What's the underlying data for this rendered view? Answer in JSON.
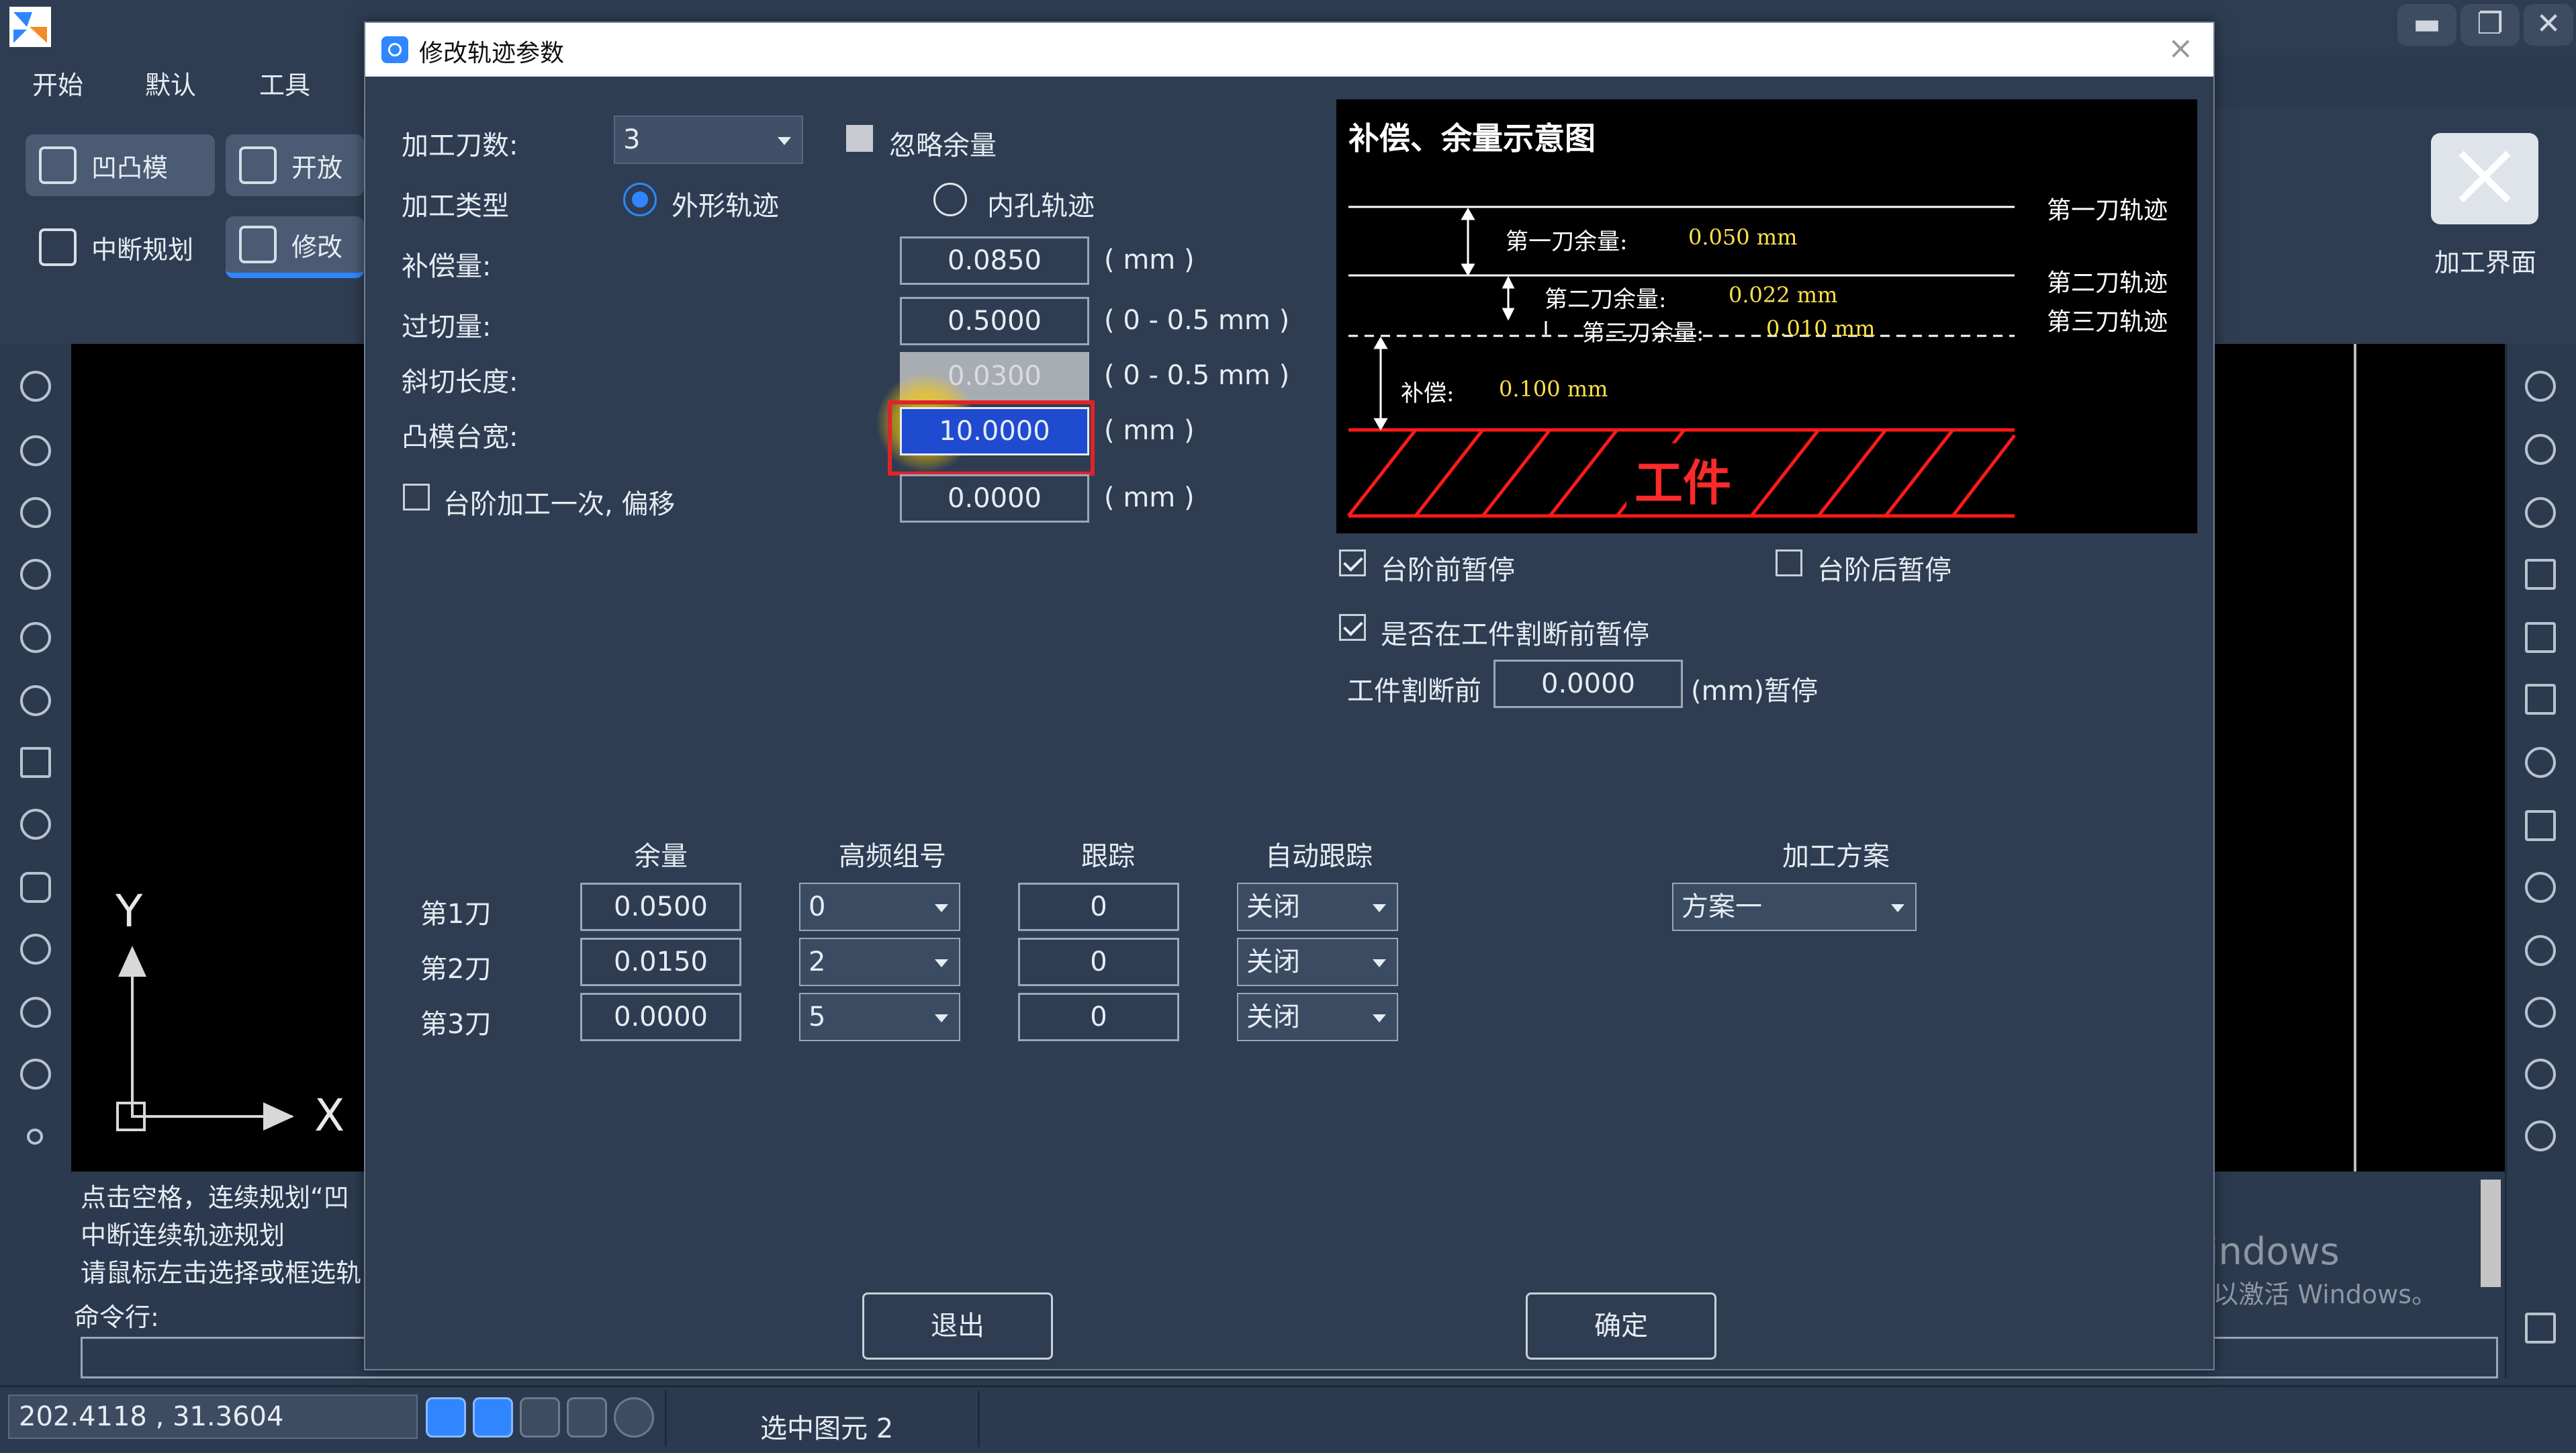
{
  "app": {
    "menu": [
      "开始",
      "默认",
      "工具"
    ],
    "ribbon": {
      "btn1": "凹凸模",
      "btn2": "开放",
      "btn3": "中断规划",
      "btn4": "修改",
      "right_label": "加工界面"
    },
    "window_controls": [
      "▬",
      "❐",
      "✕"
    ],
    "command_lines": [
      "点击空格，连续规划“凹",
      "中断连续轨迹规划",
      "请鼠标左击选择或框选轨"
    ],
    "command_label": "命令行:",
    "status": {
      "coords": "202.4118 , 31.3604",
      "selected": "选中图元 2"
    },
    "axis": {
      "y": "Y",
      "x": "X"
    },
    "watermark": {
      "line1": "激活 Windows",
      "line2": "转到“设置”以激活 Windows。"
    }
  },
  "dialog": {
    "title": "修改轨迹参数",
    "close": "×",
    "knife_count": {
      "label": "加工刀数:",
      "value": "3"
    },
    "ignore_margin": {
      "label": "忽略余量",
      "checked": false
    },
    "machining_type": {
      "label": "加工类型",
      "option_outer": "外形轨迹",
      "option_inner": "内孔轨迹",
      "selected": "外形轨迹"
    },
    "compensation": {
      "label": "补偿量:",
      "value": "0.0850",
      "unit": "( mm )"
    },
    "overcut": {
      "label": "过切量:",
      "value": "0.5000",
      "unit": "( 0 - 0.5 mm )"
    },
    "bevel": {
      "label": "斜切长度:",
      "value": "0.0300",
      "unit": "( 0 - 0.5 mm )"
    },
    "punch_width": {
      "label": "凸模台宽:",
      "value": "10.0000",
      "unit": "( mm )"
    },
    "step_once": {
      "label": "台阶加工一次, 偏移",
      "value": "0.0000",
      "unit": "( mm )",
      "checked": false
    },
    "pause_before_step": {
      "label": "台阶前暂停",
      "checked": true
    },
    "pause_after_step": {
      "label": "台阶后暂停",
      "checked": false
    },
    "pause_before_cut": {
      "label": "是否在工件割断前暂停",
      "checked": true
    },
    "cut_off": {
      "label": "工件割断前",
      "value": "0.0000",
      "unit": "(mm)暂停"
    },
    "table": {
      "headers": [
        "余量",
        "高频组号",
        "跟踪",
        "自动跟踪"
      ],
      "rows": [
        {
          "name": "第1刀",
          "margin": "0.0500",
          "group": "0",
          "track": "0",
          "auto": "关闭"
        },
        {
          "name": "第2刀",
          "margin": "0.0150",
          "group": "2",
          "track": "0",
          "auto": "关闭"
        },
        {
          "name": "第3刀",
          "margin": "0.0000",
          "group": "5",
          "track": "0",
          "auto": "关闭"
        }
      ]
    },
    "plan": {
      "label": "加工方案",
      "value": "方案一"
    },
    "exit": "退出",
    "ok": "确定",
    "diagram": {
      "title": "补偿、余量示意图",
      "track1": "第一刀轨迹",
      "track2": "第二刀轨迹",
      "track3": "第三刀轨迹",
      "margin1_label": "第一刀余量:",
      "margin1_value": "0.050 mm",
      "margin2_label": "第二刀余量:",
      "margin2_value": "0.022 mm",
      "margin3_label": "第三刀余量:",
      "margin3_value": "0.010 mm",
      "comp_label": "补偿:",
      "comp_value": "0.100 mm",
      "workpiece": "工件"
    }
  }
}
